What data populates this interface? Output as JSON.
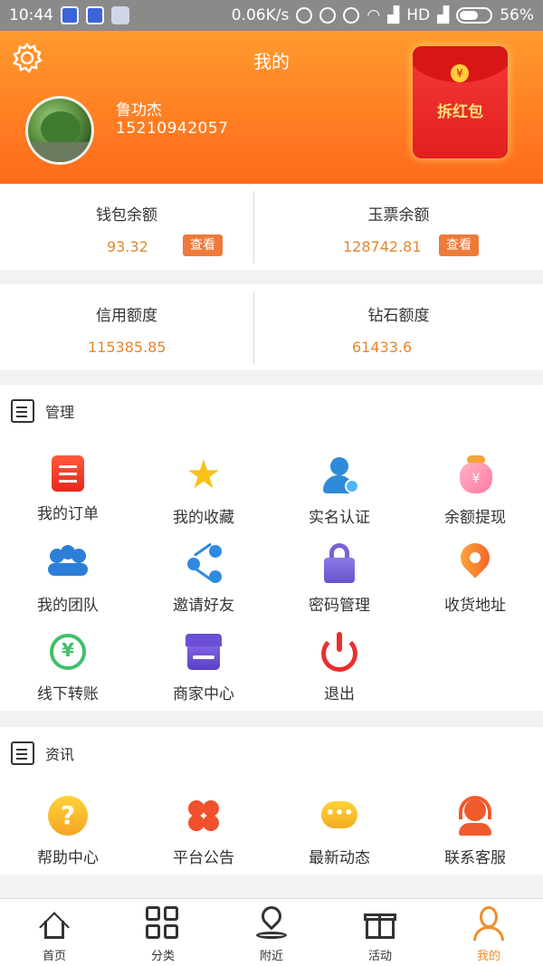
{
  "status_bar": {
    "time": "10:44",
    "speed": "0.06K/s",
    "network": "HD",
    "battery": "56%"
  },
  "header": {
    "title": "我的",
    "user_name": "鲁功杰",
    "phone": "15210942057",
    "red_packet_label": "拆红包",
    "red_packet_coin": "¥"
  },
  "balances": {
    "wallet_label": "钱包余额",
    "wallet_value": "93.32",
    "jade_label": "玉票余额",
    "jade_value": "128742.81",
    "view_label": "查看",
    "credit_label": "信用额度",
    "credit_value": "115385.85",
    "diamond_label": "钻石额度",
    "diamond_value": "61433.6"
  },
  "manage": {
    "title": "管理",
    "items": [
      {
        "label": "我的订单",
        "icon": "order-icon"
      },
      {
        "label": "我的收藏",
        "icon": "star-icon"
      },
      {
        "label": "实名认证",
        "icon": "verify-icon"
      },
      {
        "label": "余额提现",
        "icon": "money-bag-icon"
      },
      {
        "label": "我的团队",
        "icon": "team-icon"
      },
      {
        "label": "邀请好友",
        "icon": "share-icon"
      },
      {
        "label": "密码管理",
        "icon": "lock-icon"
      },
      {
        "label": "收货地址",
        "icon": "location-pin-icon"
      },
      {
        "label": "线下转账",
        "icon": "transfer-icon"
      },
      {
        "label": "商家中心",
        "icon": "store-icon"
      },
      {
        "label": "退出",
        "icon": "power-icon"
      }
    ]
  },
  "news": {
    "title": "资讯",
    "items": [
      {
        "label": "帮助中心",
        "icon": "help-icon"
      },
      {
        "label": "平台公告",
        "icon": "clover-icon"
      },
      {
        "label": "最新动态",
        "icon": "chat-bubble-icon"
      },
      {
        "label": "联系客服",
        "icon": "customer-service-icon"
      }
    ]
  },
  "bottom_nav": {
    "items": [
      {
        "label": "首页",
        "icon": "home-icon"
      },
      {
        "label": "分类",
        "icon": "grid-icon"
      },
      {
        "label": "附近",
        "icon": "map-pin-icon"
      },
      {
        "label": "活动",
        "icon": "gift-icon"
      },
      {
        "label": "我的",
        "icon": "user-icon"
      }
    ],
    "active_color": "#f08c2a"
  },
  "colors": {
    "header_top": "#ff9a2e",
    "header_bottom": "#ff6a1a",
    "value_orange": "#e7852a",
    "button_orange": "#ee7a3a"
  }
}
